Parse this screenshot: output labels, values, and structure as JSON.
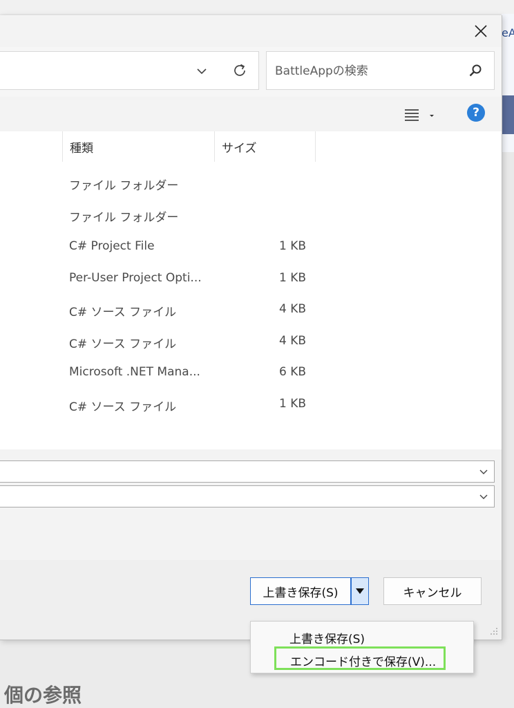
{
  "background": {
    "partial_window_text": "eA",
    "reference_title": "個の参照"
  },
  "dialog": {
    "address_bar": {
      "value": ""
    },
    "search": {
      "placeholder": "BattleAppの検索"
    },
    "columns": {
      "type": "種類",
      "size": "サイズ"
    },
    "files": [
      {
        "type": "ファイル フォルダー",
        "size": ""
      },
      {
        "type": "ファイル フォルダー",
        "size": ""
      },
      {
        "type": "C# Project File",
        "size": "1 KB"
      },
      {
        "type": "Per-User Project Opti...",
        "size": "1 KB"
      },
      {
        "type": "C# ソース ファイル",
        "size": "4 KB"
      },
      {
        "type": "C# ソース ファイル",
        "size": "4 KB"
      },
      {
        "type": "Microsoft .NET Mana...",
        "size": "6 KB"
      },
      {
        "type": "C# ソース ファイル",
        "size": "1 KB"
      }
    ],
    "buttons": {
      "save": "上書き保存(S)",
      "cancel": "キャンセル"
    },
    "save_menu": [
      {
        "label": "上書き保存(S)"
      },
      {
        "label": "エンコード付きで保存(V)...",
        "highlighted": true
      }
    ],
    "help_symbol": "?"
  },
  "colors": {
    "accent": "#2c6fcf",
    "help_icon": "#2b7fd8",
    "highlight_border": "#7ee05a"
  }
}
